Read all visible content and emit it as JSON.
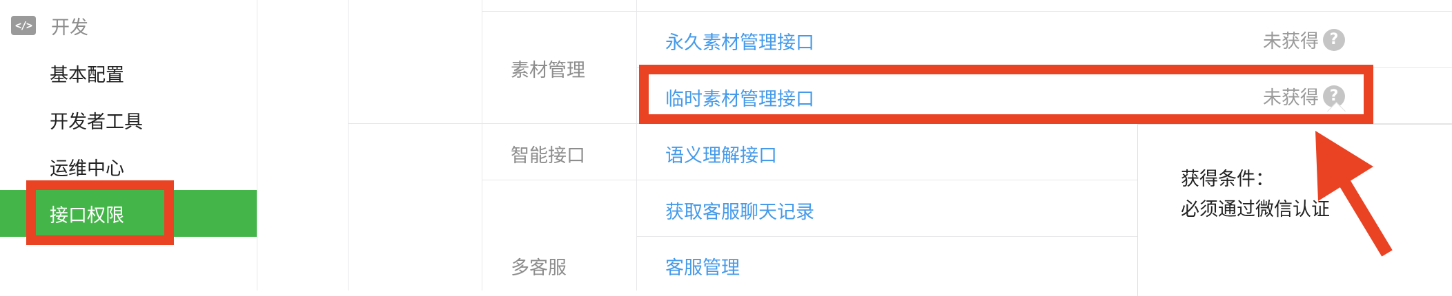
{
  "sidebar": {
    "section_label": "开发",
    "section_icon": "code-icon",
    "items": [
      {
        "label": "基本配置"
      },
      {
        "label": "开发者工具"
      },
      {
        "label": "运维中心"
      },
      {
        "label": "接口权限",
        "active": true
      }
    ]
  },
  "table": {
    "categories": {
      "material": "素材管理",
      "smart": "智能接口",
      "customer": "多客服"
    },
    "rows": {
      "permanent_material": {
        "label": "永久素材管理接口",
        "status": "未获得"
      },
      "temp_material": {
        "label": "临时素材管理接口",
        "status": "未获得"
      },
      "semantic": {
        "label": "语义理解接口"
      },
      "chat_records": {
        "label": "获取客服聊天记录"
      },
      "kf_manage": {
        "label": "客服管理"
      }
    },
    "help_icon": "?"
  },
  "tooltip": {
    "line1": "获得条件：",
    "line2": "必须通过微信认证"
  },
  "colors": {
    "accent_green": "#44b549",
    "link_blue": "#459ae9",
    "highlight_red": "#e94324"
  }
}
